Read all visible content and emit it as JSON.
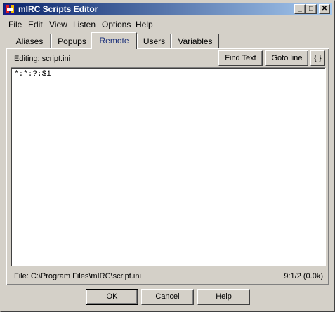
{
  "window": {
    "title": "mIRC Scripts Editor",
    "minimize_glyph": "_",
    "maximize_glyph": "□",
    "close_glyph": "✕"
  },
  "menu": [
    "File",
    "Edit",
    "View",
    "Listen",
    "Options",
    "Help"
  ],
  "tabs": [
    {
      "label": "Aliases",
      "active": false
    },
    {
      "label": "Popups",
      "active": false
    },
    {
      "label": "Remote",
      "active": true
    },
    {
      "label": "Users",
      "active": false
    },
    {
      "label": "Variables",
      "active": false
    }
  ],
  "toolbar": {
    "editing_label": "Editing: script.ini",
    "find_text": "Find Text",
    "goto_line": "Goto line",
    "braces": "{ }"
  },
  "editor": {
    "content": "*:*:?:$1"
  },
  "status": {
    "file_path": "File: C:\\Program Files\\mIRC\\script.ini",
    "position": "9:1/2 (0.0k)"
  },
  "buttons": {
    "ok": "OK",
    "cancel": "Cancel",
    "help": "Help"
  },
  "colors": {
    "titlebar_start": "#0a246a",
    "titlebar_end": "#a6caf0",
    "face": "#d4d0c8",
    "active_tab_text": "#1a2f7a"
  },
  "icons": {
    "app": "mirc-app-icon",
    "minimize": "minimize-icon",
    "maximize": "maximize-icon",
    "close": "close-icon"
  }
}
